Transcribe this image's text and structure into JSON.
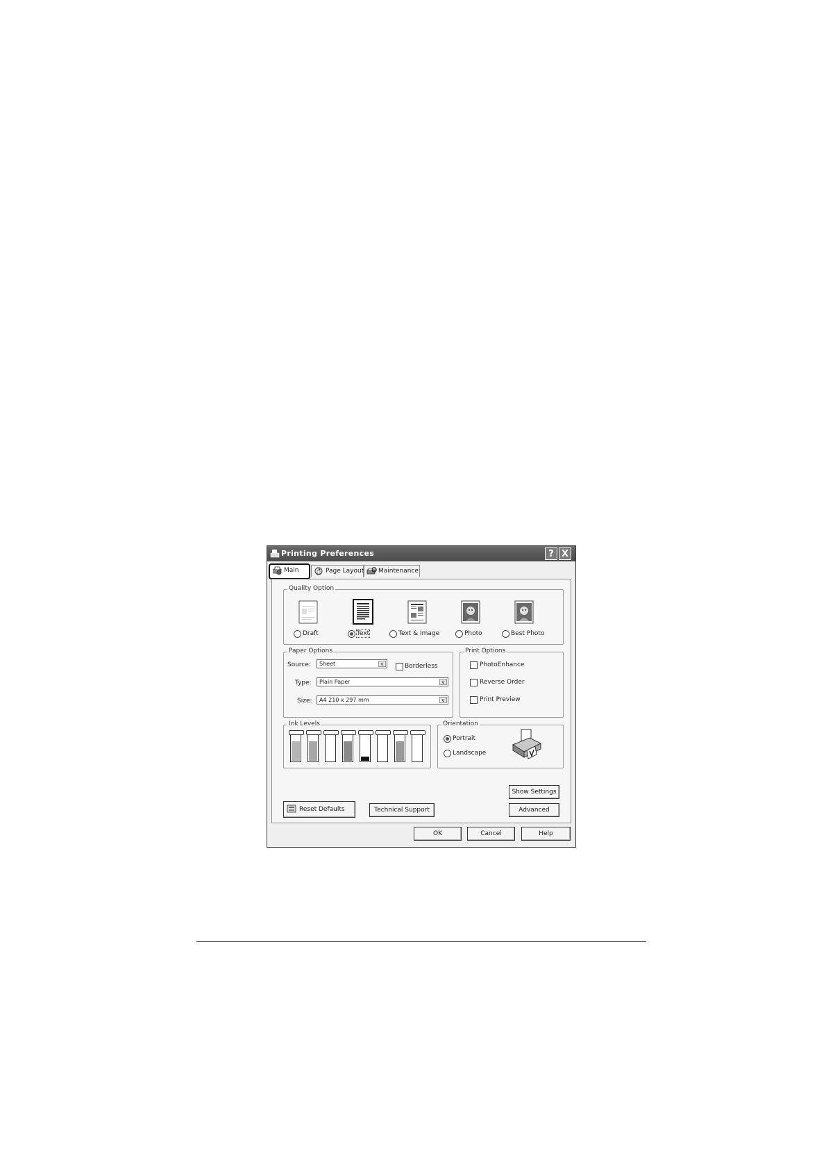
{
  "window": {
    "title": "Printing Preferences",
    "help_glyph": "?",
    "close_glyph": "X"
  },
  "tabs": [
    {
      "label": "Main",
      "icon": "printer-icon",
      "active": true
    },
    {
      "label": "Page Layout",
      "icon": "page-layout-icon",
      "active": false
    },
    {
      "label": "Maintenance",
      "icon": "maintenance-icon",
      "active": false
    }
  ],
  "quality_option": {
    "label": "Quality Option",
    "options": [
      {
        "label": "Draft",
        "icon": "draft-document-icon",
        "selected": false
      },
      {
        "label": "Text",
        "icon": "text-document-icon",
        "selected": true
      },
      {
        "label": "Text & Image",
        "icon": "text-image-document-icon",
        "selected": false
      },
      {
        "label": "Photo",
        "icon": "photo-icon",
        "selected": false
      },
      {
        "label": "Best Photo",
        "icon": "best-photo-icon",
        "selected": false
      }
    ]
  },
  "paper_options": {
    "label": "Paper Options",
    "source_label": "Source:",
    "source_value": "Sheet",
    "borderless_label": "Borderless",
    "type_label": "Type:",
    "type_value": "Plain Paper",
    "size_label": "Size:",
    "size_value": "A4 210 x 297 mm",
    "dropdown_glyph": "v"
  },
  "print_options": {
    "label": "Print Options",
    "items": [
      "PhotoEnhance",
      "Reverse Order",
      "Print Preview"
    ]
  },
  "ink_levels": {
    "label": "Ink Levels",
    "levels": [
      0.72,
      0.72,
      0.0,
      0.72,
      0.15,
      0.0,
      0.72,
      0.0
    ],
    "colors": [
      "#b5b5b5",
      "#a8a8a8",
      "#ffffff",
      "#8a8a8a",
      "#111111",
      "#ffffff",
      "#999999",
      "#ffffff"
    ]
  },
  "orientation": {
    "label": "Orientation",
    "portrait_label": "Portrait",
    "landscape_label": "Landscape",
    "selected": "Portrait"
  },
  "buttons": {
    "reset_defaults": "Reset Defaults",
    "technical_support": "Technical Support",
    "show_settings": "Show Settings",
    "advanced": "Advanced",
    "ok": "OK",
    "cancel": "Cancel",
    "help": "Help"
  }
}
